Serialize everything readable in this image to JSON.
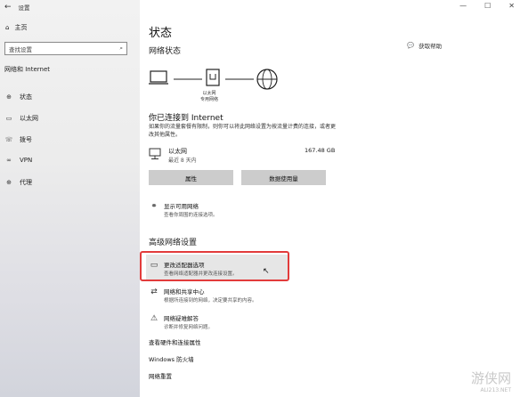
{
  "window": {
    "title": "设置",
    "controls": [
      "—",
      "☐",
      "✕"
    ]
  },
  "sidebar": {
    "home": "主页",
    "search_placeholder": "查找设置",
    "section_title": "网络和 Internet",
    "items": [
      {
        "label": "状态",
        "icon": "globe-icon"
      },
      {
        "label": "以太网",
        "icon": "monitor-icon"
      },
      {
        "label": "拨号",
        "icon": "phone-icon"
      },
      {
        "label": "VPN",
        "icon": "vpn-icon"
      },
      {
        "label": "代理",
        "icon": "globe-icon"
      }
    ]
  },
  "main": {
    "title": "状态",
    "subtitle": "网络状态",
    "help": "获取帮助",
    "diagram_label_1": "以太网",
    "diagram_label_2": "专用网络",
    "connected": "你已连接到 Internet",
    "description": "如果你的流量套餐有限制，则你可以将此网络设置为按流量计费的连接，或者更改其他属性。",
    "adapter": {
      "name": "以太网",
      "sub": "最近 8 天内",
      "usage": "167.48 GB"
    },
    "buttons": {
      "properties": "属性",
      "data_usage": "数据使用量"
    },
    "show_networks": {
      "title": "显示可用网络",
      "desc": "查看你周围的连接选项。"
    },
    "advanced_title": "高级网络设置",
    "change_adapter": {
      "title": "更改适配器选项",
      "desc": "查看网络适配器并更改连接设置。"
    },
    "sharing_center": {
      "title": "网络和共享中心",
      "desc": "根据所连接到的网络，决定要共享的内容。"
    },
    "troubleshooter": {
      "title": "网络疑难解答",
      "desc": "诊断并修复网络问题。"
    },
    "hardware_link": "查看硬件和连接属性",
    "firewall_link": "Windows 防火墙",
    "reset_link": "网络重置"
  },
  "watermark": {
    "text": "游侠网",
    "sub": "ALI213.NET"
  },
  "colors": {
    "highlight_border": "#e23b3b",
    "button_bg": "#cccccc"
  }
}
